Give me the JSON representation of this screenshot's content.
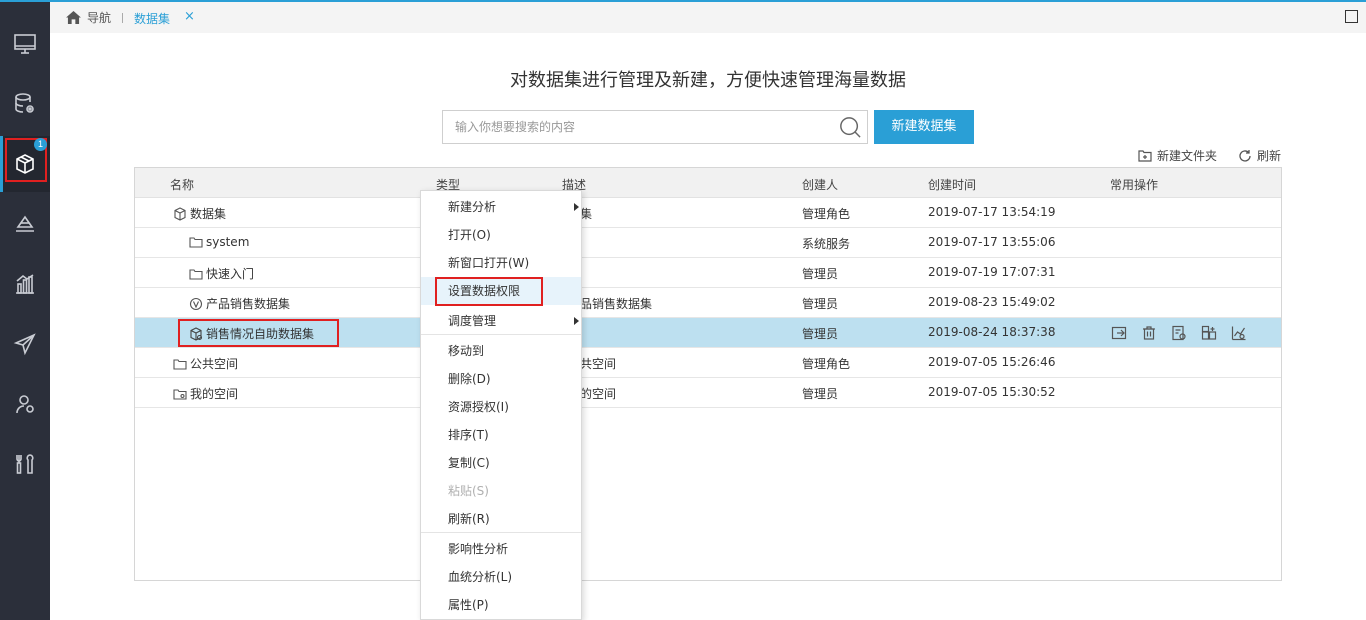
{
  "tabs": {
    "home_label": "导航",
    "active_label": "数据集",
    "close_glyph": "×"
  },
  "sidebar": {
    "items": [
      {
        "icon": "monitor-icon"
      },
      {
        "icon": "database-settings-icon"
      },
      {
        "icon": "cube-icon",
        "badge": "1"
      },
      {
        "icon": "layers-icon"
      },
      {
        "icon": "bar-chart-icon"
      },
      {
        "icon": "send-icon"
      },
      {
        "icon": "user-settings-icon"
      },
      {
        "icon": "tools-icon"
      }
    ]
  },
  "main": {
    "headline": "对数据集进行管理及新建，方便快速管理海量数据",
    "search_placeholder": "输入你想要搜索的内容",
    "new_dataset_label": "新建数据集",
    "new_folder_label": "新建文件夹",
    "refresh_label": "刷新"
  },
  "table": {
    "columns": [
      "名称",
      "类型",
      "描述",
      "创建人",
      "创建时间",
      "常用操作"
    ],
    "rows": [
      {
        "name": "数据集",
        "desc_visible": "集",
        "creator": "管理角色",
        "time": "2019-07-17 13:54:19"
      },
      {
        "name": "system",
        "desc_visible": "",
        "creator": "系统服务",
        "time": "2019-07-17 13:55:06"
      },
      {
        "name": "快速入门",
        "desc_visible": "",
        "creator": "管理员",
        "time": "2019-07-19 17:07:31"
      },
      {
        "name": "产品销售数据集",
        "desc_visible": "品销售数据集",
        "creator": "管理员",
        "time": "2019-08-23 15:49:02"
      },
      {
        "name": "销售情况自助数据集",
        "desc_visible": "",
        "creator": "管理员",
        "time": "2019-08-24 18:37:38"
      },
      {
        "name": "公共空间",
        "desc_visible": "共空间",
        "creator": "管理角色",
        "time": "2019-07-05 15:26:46"
      },
      {
        "name": "我的空间",
        "desc_visible": "的空间",
        "creator": "管理员",
        "time": "2019-07-05 15:30:52"
      }
    ]
  },
  "context_menu": {
    "items": [
      "新建分析",
      "打开(O)",
      "新窗口打开(W)",
      "设置数据权限",
      "调度管理",
      "移动到",
      "删除(D)",
      "资源授权(I)",
      "排序(T)",
      "复制(C)",
      "粘贴(S)",
      "刷新(R)",
      "影响性分析",
      "血统分析(L)",
      "属性(P)"
    ]
  },
  "colors": {
    "accent": "#2a9fd6",
    "sidebar_bg": "#2b2f3a",
    "selected_row": "#bde0f0",
    "highlight_box": "#e02020"
  }
}
